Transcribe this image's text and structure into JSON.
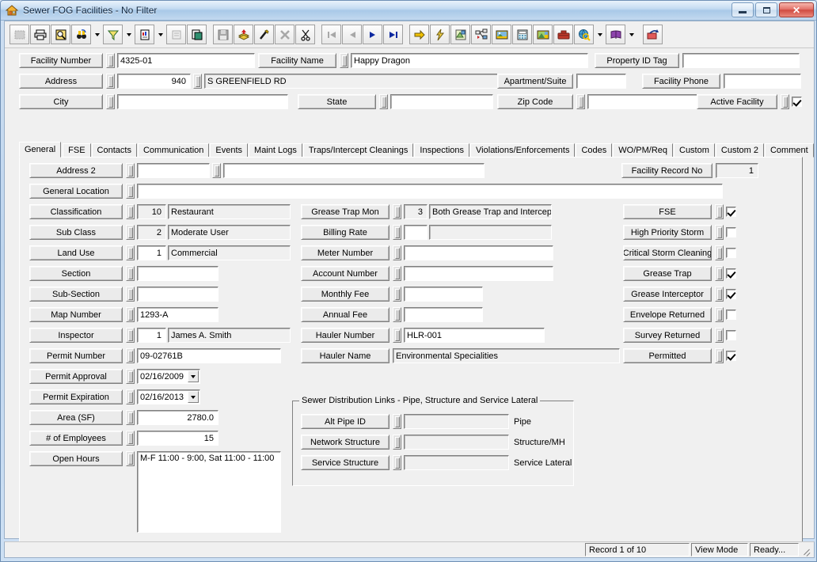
{
  "window": {
    "title": "Sewer FOG Facilities - No Filter",
    "icon": "house-icon",
    "buttons": {
      "minimize": "minimize-icon",
      "maximize": "maximize-icon",
      "close": "✕"
    }
  },
  "toolbar": {
    "items": [
      {
        "name": "grid-view-icon",
        "disabled": true,
        "framed": true
      },
      {
        "name": "print-icon",
        "disabled": false,
        "framed": true
      },
      {
        "name": "print-preview-icon",
        "disabled": false,
        "framed": true
      },
      {
        "name": "find-icon",
        "disabled": false,
        "framed": true,
        "dropdown": true
      },
      {
        "name": "filter-icon",
        "disabled": false,
        "framed": true,
        "dropdown": true
      },
      {
        "name": "report-icon",
        "disabled": false,
        "framed": true,
        "dropdown": true
      },
      {
        "name": "properties-icon",
        "disabled": true,
        "framed": true
      },
      {
        "name": "export-icon",
        "disabled": false,
        "framed": true
      },
      {
        "separator": true
      },
      {
        "name": "save-icon",
        "disabled": true,
        "framed": true
      },
      {
        "name": "add-record-icon",
        "disabled": false,
        "framed": true
      },
      {
        "name": "edit-record-icon",
        "disabled": false,
        "framed": true
      },
      {
        "name": "delete-record-icon",
        "disabled": true,
        "framed": true
      },
      {
        "name": "cut-icon",
        "disabled": false,
        "framed": true
      },
      {
        "separator": true
      },
      {
        "name": "first-record-icon",
        "disabled": true,
        "framed": true
      },
      {
        "name": "previous-record-icon",
        "disabled": true,
        "framed": true
      },
      {
        "name": "next-record-icon",
        "disabled": false,
        "framed": true
      },
      {
        "name": "last-record-icon",
        "disabled": false,
        "framed": true
      },
      {
        "separator": true
      },
      {
        "name": "goto-icon",
        "disabled": false,
        "framed": true
      },
      {
        "name": "quick-action-icon",
        "disabled": false,
        "framed": true
      },
      {
        "name": "map-layers-icon",
        "disabled": false,
        "framed": true
      },
      {
        "name": "network-icon",
        "disabled": false,
        "framed": true
      },
      {
        "name": "image-icon",
        "disabled": false,
        "framed": true
      },
      {
        "name": "calculator-icon",
        "disabled": false,
        "framed": true
      },
      {
        "name": "photo-icon",
        "disabled": false,
        "framed": true
      },
      {
        "name": "toolbox-icon",
        "disabled": false,
        "framed": true
      },
      {
        "name": "globe-search-icon",
        "disabled": false,
        "framed": true,
        "dropdown": true
      },
      {
        "name": "help-book-icon",
        "disabled": false,
        "framed": true,
        "dropdown": true
      },
      {
        "separator": true
      },
      {
        "name": "exit-icon",
        "disabled": false,
        "framed": true
      }
    ]
  },
  "header": {
    "facility_number": {
      "label": "Facility Number",
      "value": "4325-01"
    },
    "facility_name": {
      "label": "Facility Name",
      "value": "Happy Dragon"
    },
    "property_id_tag": {
      "label": "Property ID Tag",
      "value": ""
    },
    "address": {
      "label": "Address",
      "number": "940",
      "street": "S GREENFIELD RD"
    },
    "apartment_suite": {
      "label": "Apartment/Suite",
      "value": ""
    },
    "facility_phone": {
      "label": "Facility Phone",
      "value": ""
    },
    "city": {
      "label": "City",
      "value": ""
    },
    "state": {
      "label": "State",
      "value": ""
    },
    "zip_code": {
      "label": "Zip Code",
      "value": ""
    },
    "active_facility": {
      "label": "Active Facility",
      "checked": true
    }
  },
  "tabs": [
    {
      "label": "General",
      "active": true
    },
    {
      "label": "FSE",
      "active": false
    },
    {
      "label": "Contacts",
      "active": false
    },
    {
      "label": "Communication",
      "active": false
    },
    {
      "label": "Events",
      "active": false
    },
    {
      "label": "Maint Logs",
      "active": false
    },
    {
      "label": "Traps/Intercept Cleanings",
      "active": false
    },
    {
      "label": "Inspections",
      "active": false
    },
    {
      "label": "Violations/Enforcements",
      "active": false
    },
    {
      "label": "Codes",
      "active": false
    },
    {
      "label": "WO/PM/Req",
      "active": false
    },
    {
      "label": "Custom",
      "active": false
    },
    {
      "label": "Custom 2",
      "active": false
    },
    {
      "label": "Comment",
      "active": false
    }
  ],
  "general": {
    "address2": {
      "label": "Address 2",
      "value1": "",
      "value2": ""
    },
    "general_location": {
      "label": "General Location",
      "value": ""
    },
    "facility_record_no": {
      "label": "Facility Record No",
      "value": "1"
    },
    "left_column": [
      {
        "label": "Classification",
        "code": "10",
        "desc": "Restaurant",
        "code_readonly": true,
        "has_desc": true
      },
      {
        "label": "Sub Class",
        "code": "2",
        "desc": "Moderate User",
        "code_readonly": true,
        "has_desc": true
      },
      {
        "label": "Land Use",
        "code": "1",
        "desc": "Commercial",
        "code_readonly": false,
        "has_desc": true
      },
      {
        "label": "Section",
        "code": "",
        "desc": null,
        "code_readonly": false,
        "has_desc": false
      },
      {
        "label": "Sub-Section",
        "code": "",
        "desc": null,
        "code_readonly": false,
        "has_desc": false
      },
      {
        "label": "Map Number",
        "code": "1293-A",
        "desc": null,
        "code_readonly": false,
        "has_desc": false,
        "wide": true
      },
      {
        "label": "Inspector",
        "code": "1",
        "desc": "James A. Smith",
        "code_readonly": false,
        "has_desc": true
      },
      {
        "label": "Permit Number",
        "code": "09-02761B",
        "desc": null,
        "code_readonly": false,
        "has_desc": false,
        "wide": true
      }
    ],
    "permit_approval": {
      "label": "Permit Approval",
      "value": "02/16/2009"
    },
    "permit_expiration": {
      "label": "Permit Expiration",
      "value": "02/16/2013"
    },
    "area_sf": {
      "label": "Area (SF)",
      "value": "2780.0"
    },
    "num_employees": {
      "label": "# of Employees",
      "value": "15"
    },
    "open_hours": {
      "label": "Open Hours",
      "value": "M-F 11:00 - 9:00, Sat 11:00 - 11:00"
    },
    "middle_column": [
      {
        "label": "Grease Trap Mon",
        "code": "3",
        "desc": "Both Grease Trap and Intercept",
        "type": "code-desc",
        "code_readonly": true
      },
      {
        "label": "Billing Rate",
        "code": "",
        "desc": "",
        "type": "code-desc",
        "code_readonly": false
      },
      {
        "label": "Meter Number",
        "value": "",
        "type": "text-wide"
      },
      {
        "label": "Account Number",
        "value": "",
        "type": "text-wide"
      },
      {
        "label": "Monthly Fee",
        "value": "",
        "type": "text-med"
      },
      {
        "label": "Annual Fee",
        "value": "",
        "type": "text-med"
      },
      {
        "label": "Hauler Number",
        "value": "HLR-001",
        "type": "text-wide",
        "white": true
      },
      {
        "label": "Hauler Name",
        "value": "Environmental Specialities",
        "type": "text-nospin"
      }
    ],
    "checkboxes": [
      {
        "label": "FSE",
        "checked": true
      },
      {
        "label": "High Priority Storm",
        "checked": false
      },
      {
        "label": "Critical Storm Cleaning",
        "checked": false
      },
      {
        "label": "Grease Trap",
        "checked": true
      },
      {
        "label": "Grease Interceptor",
        "checked": true
      },
      {
        "label": "Envelope Returned",
        "checked": false
      },
      {
        "label": "Survey Returned",
        "checked": false
      },
      {
        "label": "Permitted",
        "checked": true
      }
    ],
    "sewer_links": {
      "title": "Sewer Distribution Links - Pipe, Structure and Service Lateral",
      "rows": [
        {
          "label": "Alt Pipe ID",
          "value": "",
          "suffix": "Pipe"
        },
        {
          "label": "Network Structure",
          "value": "",
          "suffix": "Structure/MH"
        },
        {
          "label": "Service Structure",
          "value": "",
          "suffix": "Service Lateral"
        }
      ]
    }
  },
  "statusbar": {
    "record": "Record 1 of 10",
    "mode": "View Mode",
    "state": "Ready..."
  }
}
